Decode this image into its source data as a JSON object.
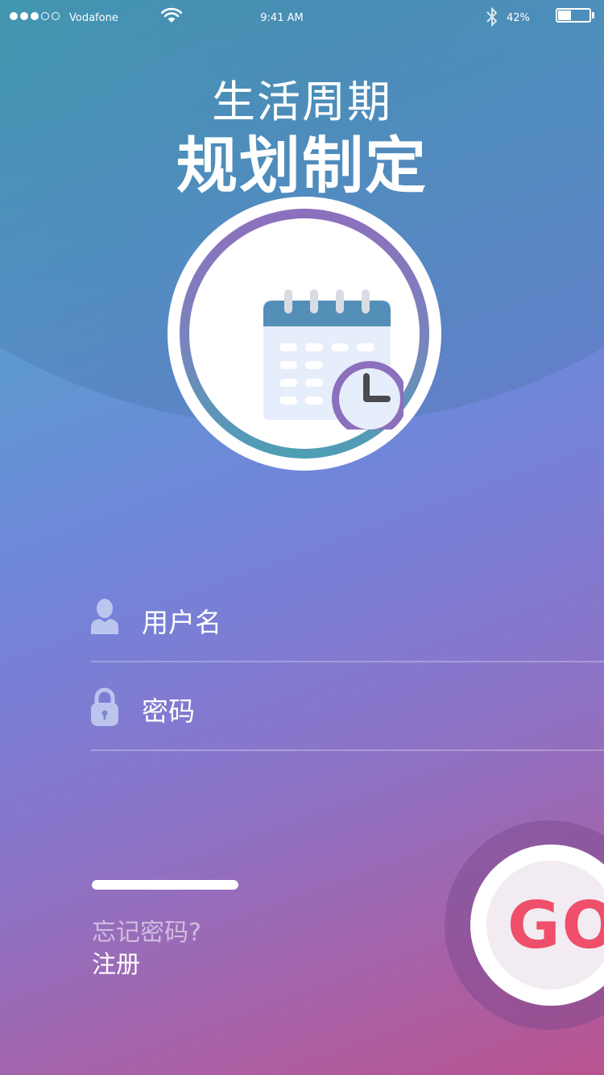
{
  "status_bar": {
    "signal_dots_filled": 3,
    "signal_dots_total": 5,
    "carrier": "Vodafone",
    "time": "9:41 AM",
    "battery_percent": "42%",
    "battery_level": 0.42
  },
  "header": {
    "title_line1": "生活周期",
    "title_line2": "规划制定"
  },
  "emblem": {
    "icon": "calendar-clock-icon"
  },
  "form": {
    "username_label": "用户名",
    "username_icon": "user-icon",
    "password_label": "密码",
    "password_icon": "lock-icon"
  },
  "progress": {
    "fraction": 1.0
  },
  "links": {
    "forgot_password": "忘记密码?",
    "register": "注册"
  },
  "go_button": {
    "label": "GO"
  },
  "colors": {
    "go_text": "#ef4f6a",
    "ring_top": "#8e6fbd",
    "ring_bottom": "#4c9fb4",
    "calendar_header": "#548fb8",
    "clock_ring": "#8c6fbd"
  }
}
